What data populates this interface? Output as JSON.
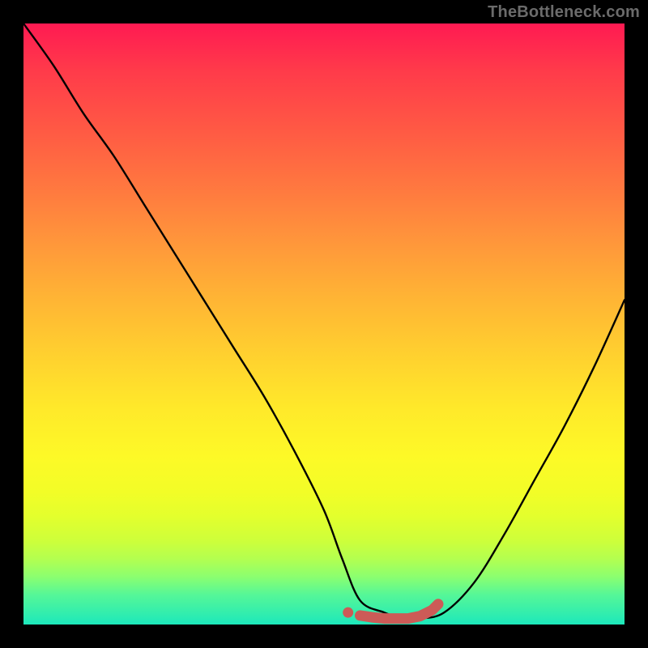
{
  "watermark": "TheBottleneck.com",
  "colors": {
    "background": "#000000",
    "curve_stroke": "#000000",
    "marker_stroke": "#cc5b57",
    "marker_fill": "#cc5b57",
    "gradient_top": "#ff1a52",
    "gradient_mid": "#ffd02f",
    "gradient_bottom": "#0ee0c6"
  },
  "chart_data": {
    "type": "line",
    "title": "",
    "xlabel": "",
    "ylabel": "",
    "xlim": [
      0,
      100
    ],
    "ylim": [
      0,
      100
    ],
    "grid": false,
    "legend": false,
    "series": [
      {
        "name": "bottleneck-curve",
        "x": [
          0,
          5,
          10,
          15,
          20,
          25,
          30,
          35,
          40,
          45,
          50,
          53,
          56,
          60,
          63,
          66,
          70,
          75,
          80,
          85,
          90,
          95,
          100
        ],
        "y": [
          100,
          93,
          85,
          78,
          70,
          62,
          54,
          46,
          38,
          29,
          19,
          11,
          4,
          2,
          1,
          1,
          2,
          7,
          15,
          24,
          33,
          43,
          54
        ]
      }
    ],
    "markers": [
      {
        "name": "flat-segment-start-dot",
        "x": 54,
        "y": 2
      },
      {
        "name": "flat-segment-path",
        "points": [
          {
            "x": 56,
            "y": 1.5
          },
          {
            "x": 58,
            "y": 1.2
          },
          {
            "x": 60,
            "y": 1.0
          },
          {
            "x": 62,
            "y": 1.0
          },
          {
            "x": 64,
            "y": 1.0
          },
          {
            "x": 66,
            "y": 1.4
          },
          {
            "x": 68,
            "y": 2.4
          },
          {
            "x": 69,
            "y": 3.4
          }
        ]
      }
    ],
    "annotations": []
  }
}
